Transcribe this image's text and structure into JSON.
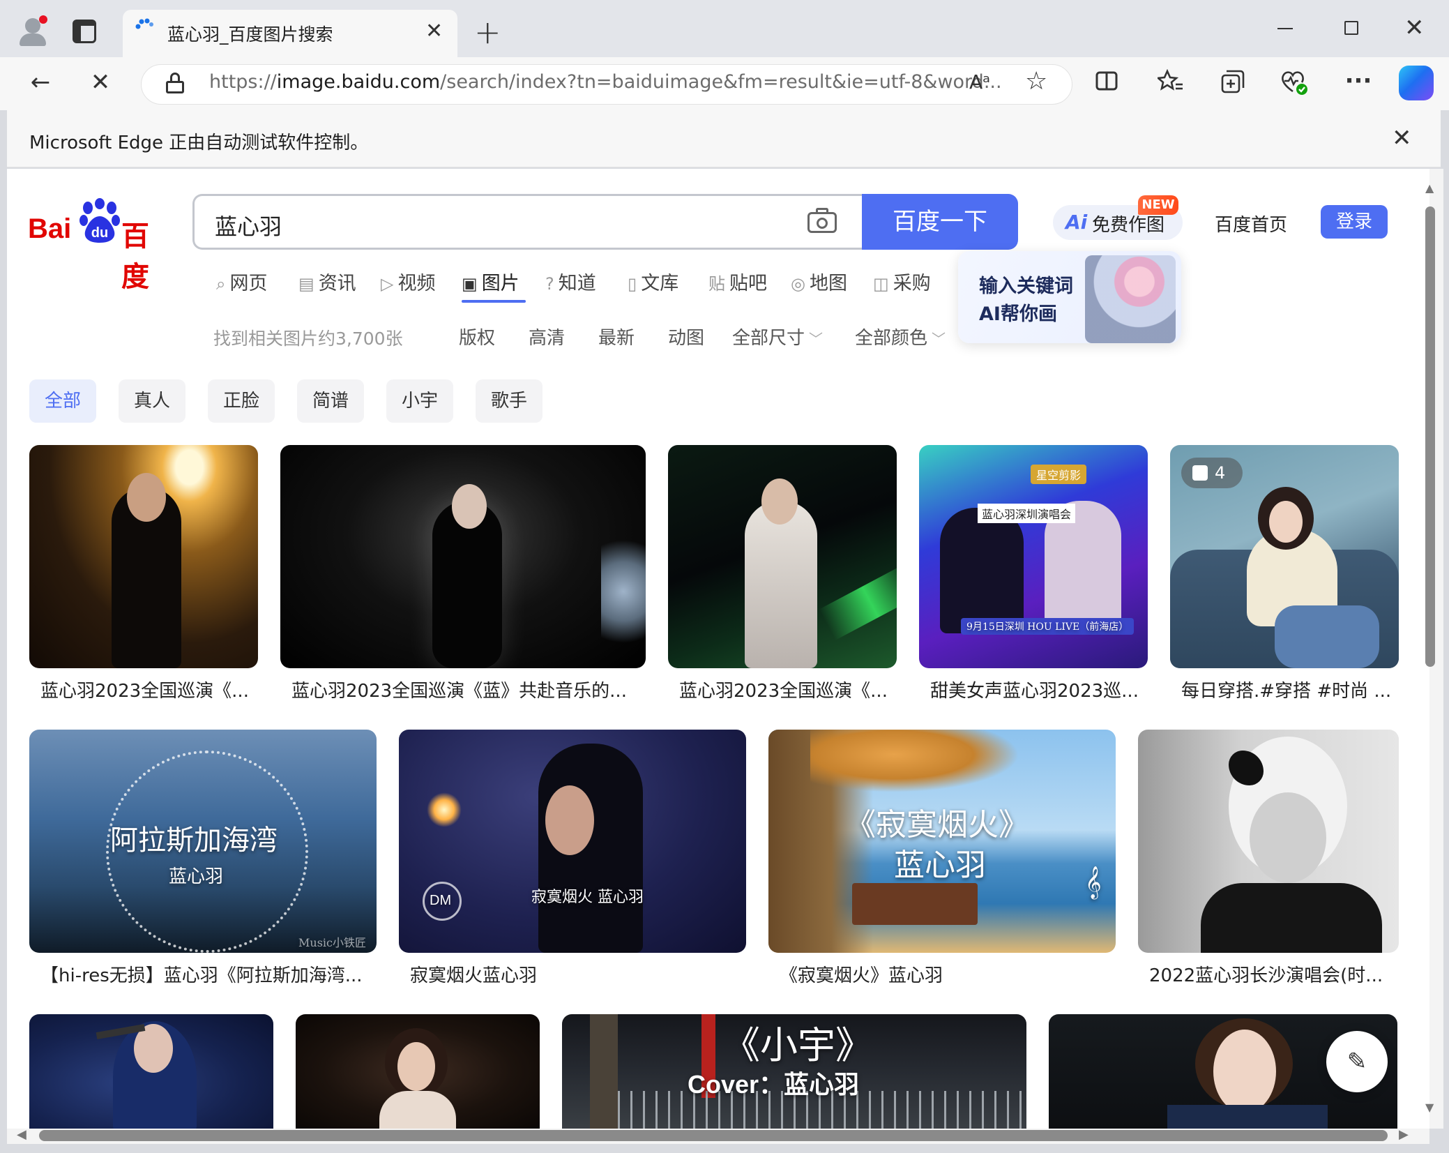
{
  "browser": {
    "tab_title": "蓝心羽_百度图片搜索",
    "tab_close": "✕",
    "new_tab": "+",
    "url_prefix": "https://",
    "url_host": "image.baidu.com",
    "url_path": "/search/index?tn=baiduimage&fm=result&ie=utf-8&word...",
    "read_aloud": "Aᵃ",
    "infobar_text": "Microsoft Edge 正由自动测试软件控制。",
    "icons": [
      "profile-icon",
      "tab-actions-icon",
      "back-icon",
      "stop-icon",
      "lock-icon",
      "read-aloud-icon",
      "star-icon",
      "split-screen-icon",
      "favorites-icon",
      "collections-icon",
      "browser-essentials-icon",
      "more-icon",
      "copilot-icon"
    ]
  },
  "header": {
    "logo_left": "Bai",
    "logo_mid": "du",
    "logo_right": "百度",
    "search_value": "蓝心羽",
    "search_button": "百度一下",
    "ai_logo": "Ai",
    "ai_label": "免费作图",
    "new_badge": "NEW",
    "home_link": "百度首页",
    "login": "登录"
  },
  "nav": [
    {
      "icon": "⌕",
      "label": "网页"
    },
    {
      "icon": "▤",
      "label": "资讯"
    },
    {
      "icon": "▷",
      "label": "视频"
    },
    {
      "icon": "▣",
      "label": "图片"
    },
    {
      "icon": "?",
      "label": "知道"
    },
    {
      "icon": "▯",
      "label": "文库"
    },
    {
      "icon": "贴",
      "label": "贴吧"
    },
    {
      "icon": "◎",
      "label": "地图"
    },
    {
      "icon": "◫",
      "label": "采购"
    }
  ],
  "ai_popup": {
    "line1": "输入关键词",
    "line2": "AI帮你画"
  },
  "filters": {
    "count": "找到相关图片约3,700张",
    "items": [
      "版权",
      "高清",
      "最新",
      "动图",
      "全部尺寸",
      "全部颜色"
    ],
    "chevron": "﹀"
  },
  "chips": [
    "全部",
    "真人",
    "正脸",
    "简谱",
    "小宇",
    "歌手"
  ],
  "results": {
    "row1": [
      {
        "caption": "蓝心羽2023全国巡演《..."
      },
      {
        "caption": "蓝心羽2023全国巡演《蓝》共赴音乐的..."
      },
      {
        "caption": "蓝心羽2023全国巡演《..."
      },
      {
        "caption": "甜美女声蓝心羽2023巡...",
        "overlay_top": "星空剪影",
        "overlay_mid": "蓝心羽深圳演唱会",
        "overlay_bottom": "9月15日深圳 HOU LIVE（前海店）"
      },
      {
        "caption": "每日穿搭.#穿搭 #时尚 ...",
        "badge_count": "4"
      }
    ],
    "row2": [
      {
        "caption": "【hi-res无损】蓝心羽《阿拉斯加海湾...",
        "overlay_title": "阿拉斯加海湾",
        "overlay_sub": "蓝心羽",
        "watermark": "Music小铁匠"
      },
      {
        "caption": "寂寞烟火蓝心羽",
        "overlay_title": "寂寞烟火  蓝心羽",
        "overlay_logo": "DM"
      },
      {
        "caption": "《寂寞烟火》蓝心羽",
        "overlay_title": "《寂寞烟火》",
        "overlay_sub": "蓝心羽"
      },
      {
        "caption": "2022蓝心羽长沙演唱会(时..."
      }
    ],
    "row3": [
      {
        "caption": ""
      },
      {
        "caption": ""
      },
      {
        "caption": "",
        "overlay_title": "《小宇》",
        "overlay_sub": "Cover：蓝心羽"
      },
      {
        "caption": ""
      }
    ]
  },
  "edit_fab": "✎",
  "colors": {
    "accent": "#4e6ef2",
    "logo_red": "#e10602",
    "new_badge": "#ff5a26"
  }
}
